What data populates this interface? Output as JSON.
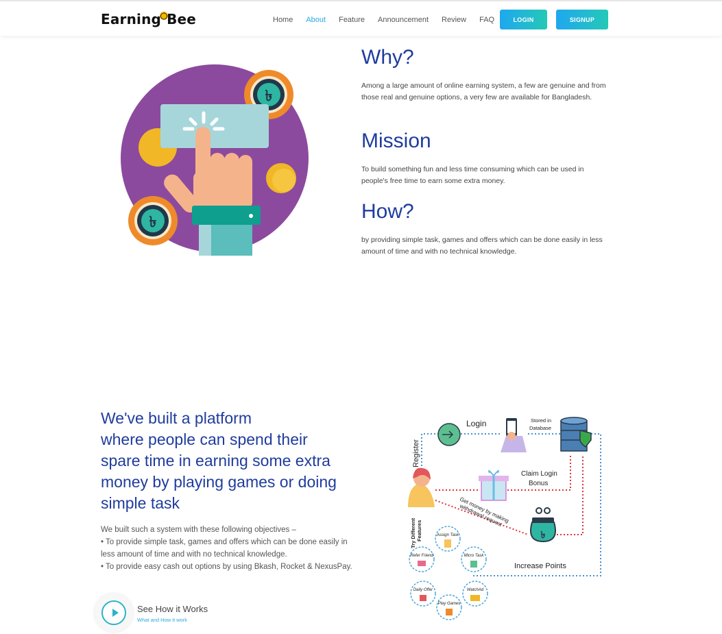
{
  "brand": {
    "name_part1": "Earning",
    "name_part2": "Bee"
  },
  "nav": {
    "items": [
      {
        "label": "Home",
        "active": false
      },
      {
        "label": "About",
        "active": true
      },
      {
        "label": "Feature",
        "active": false
      },
      {
        "label": "Announcement",
        "active": false
      },
      {
        "label": "Review",
        "active": false
      },
      {
        "label": "FAQ",
        "active": false
      }
    ],
    "login_label": "LOGIN",
    "signup_label": "SIGNUP"
  },
  "about": {
    "why_title": "Why?",
    "why_text": "Among a large amount of online earning system, a few are genuine and from those real and genuine options, a very few are available for Bangladesh.",
    "mission_title": "Mission",
    "mission_text": "To build something fun and less time consuming which can be used in people's free time to earn some extra money.",
    "how_title": "How?",
    "how_text": "by providing simple task, games and offers which can be done easily in less amount of time and with no technical knowledge."
  },
  "platform": {
    "heading_lines": [
      "We've built a platform",
      "where people can spend their",
      "spare time in earning some extra",
      "money by playing games or doing",
      "simple task"
    ],
    "intro": "We built such a system with these following objectives –",
    "bullets": [
      "• To provide simple task, games and offers which can be done easily in less amount of time and with no technical knowledge.",
      "• To provide easy cash out options by using Bkash, Rocket & NexusPay."
    ],
    "cta_title": "See How it Works",
    "cta_sub": "What and How it work"
  },
  "flow_diagram": {
    "register": "Register",
    "login": "Login",
    "stored": "Stored in",
    "database": "Database",
    "claim_login": "Claim Login",
    "bonus": "Bonus",
    "get_money": "Get money by making",
    "withdrawal": "withdrawal request",
    "try_different": "Try Different",
    "features": "Features",
    "increase_points": "Increase Points",
    "features_list": [
      "Assign Task",
      "Refer Friend",
      "Micro Task",
      "Daily Offer",
      "WatchAd",
      "Play Games"
    ]
  },
  "colors": {
    "accent": "#29a9e1",
    "heading": "#1f3c9e",
    "purple": "#8c4a9e",
    "teal": "#2cb3c8"
  },
  "icons": [
    "bee-icon",
    "play-icon",
    "taka-coin-icon",
    "database-icon",
    "gift-icon",
    "wallet-icon"
  ]
}
